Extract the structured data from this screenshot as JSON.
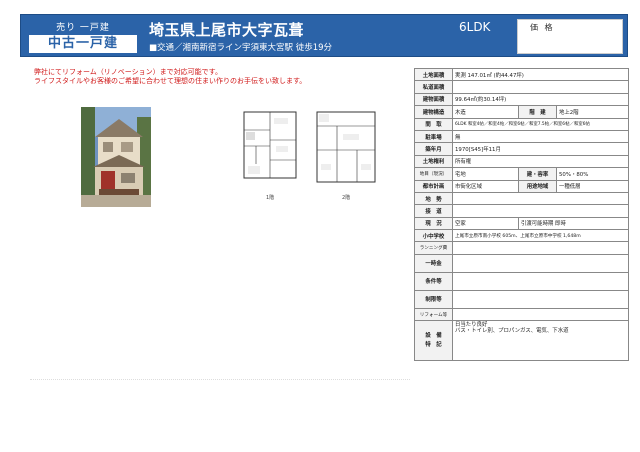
{
  "header": {
    "badge_top": "売り 一戸建",
    "badge_bottom": "中古一戸建",
    "title": "埼玉県上尾市大字瓦葺",
    "access": "■交通／湘南新宿ライン宇須東大宮駅 徒歩19分",
    "layout": "6LDK",
    "price_label": "価 格"
  },
  "notice": {
    "line1": "弊社にてリフォーム（リノベーション）まで対応可能です。",
    "line2": "ライフスタイルやお客様のご希望に合わせて理想の住まい作りのお手伝をい致します。"
  },
  "floorplans": {
    "floor1": "1階",
    "floor2": "2階"
  },
  "specs": {
    "land_area_label": "土地面積",
    "land_area": "実測 147.01㎡ (約44.47坪)",
    "private_road_label": "私道面積",
    "private_road": "",
    "building_area_label": "建物面積",
    "building_area": "99.64㎡(約30.14坪)",
    "structure_label": "建物構造",
    "structure": "木造",
    "floors_label": "階　建",
    "floors": "地上2階",
    "layout_label": "間　取",
    "layout": "6LDK 和室4帖／和室4帖／和室6帖／和室7.5帖／和室6帖／和室6帖",
    "parking_label": "駐車場",
    "parking": "無",
    "built_label": "築年月",
    "built": "1970[S45]年11月",
    "land_rights_label": "土地権利",
    "land_rights": "所有権",
    "land_category_label": "地目（現況）",
    "land_category": "宅地",
    "coverage_label": "建・容率",
    "coverage": "50%・80%",
    "city_planning_label": "都市計画",
    "city_planning": "市街化区域",
    "zoning_label": "用途地域",
    "zoning": "一種低層",
    "seismic_label": "地　勢",
    "seismic": "",
    "road_label": "接　道",
    "road": "",
    "status_label": "現　況",
    "status": "空家",
    "handover": "引渡可能時期 即時",
    "school_label": "小中学校",
    "school": "上尾市立原市南小学校 605m、上尾市立原市中学校 1,648m",
    "running_label": "ランニング費",
    "running": "",
    "lump_label": "一時金",
    "lump": "",
    "conditions_label": "条件等",
    "conditions": "",
    "restrictions_label": "制限等",
    "restrictions": "",
    "reform_label": "リフォーム等",
    "reform": "",
    "facilities_label": "設　備\n特　記",
    "facilities_line1": "日当たり良好",
    "facilities_line2": "バス・トイレ別、プロパンガス、電気、下水道"
  },
  "colors": {
    "header_bg": "#2b63a8",
    "notice_red": "#d01818"
  }
}
